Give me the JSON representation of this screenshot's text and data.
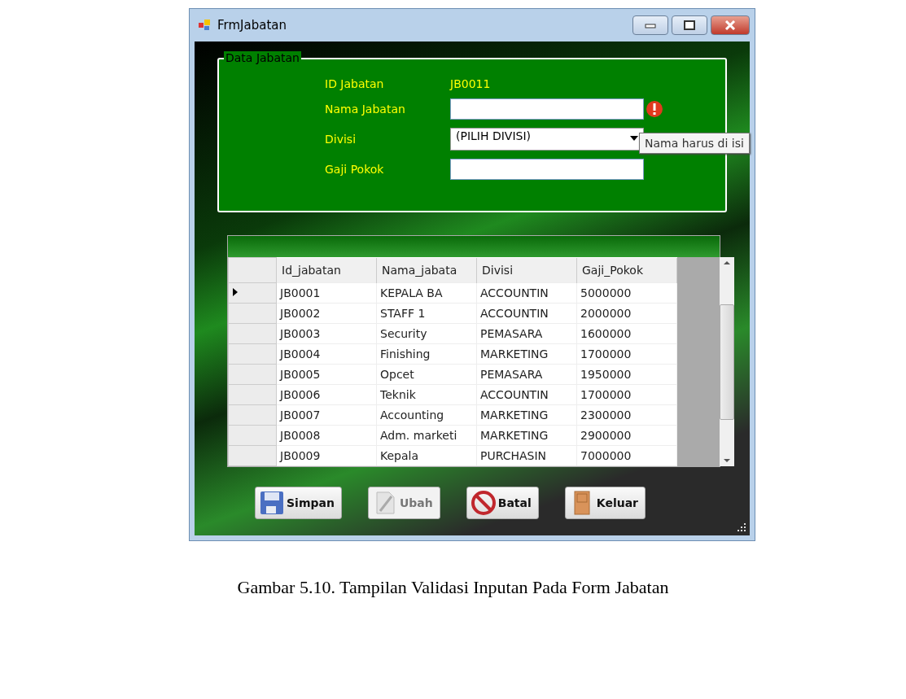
{
  "window": {
    "title": "FrmJabatan"
  },
  "group": {
    "title": "Data Jabatan",
    "fields": [
      {
        "kind": "text",
        "label": "ID Jabatan",
        "value": "JB0011",
        "error": false
      },
      {
        "kind": "input",
        "label": "Nama Jabatan",
        "error": true
      },
      {
        "kind": "combo",
        "label": "Divisi",
        "value": "(PILIH DIVISI)",
        "error": false
      },
      {
        "kind": "input",
        "label": "Gaji Pokok",
        "error": false
      }
    ]
  },
  "tooltip": "Nama harus di isi",
  "table": {
    "columns": [
      "Id_jabatan",
      "Nama_jabata",
      "Divisi",
      "Gaji_Pokok"
    ],
    "rows": [
      {
        "selected": true,
        "cells": [
          "JB0001",
          "KEPALA BA",
          "ACCOUNTIN",
          "5000000"
        ]
      },
      {
        "selected": false,
        "cells": [
          "JB0002",
          "STAFF 1",
          "ACCOUNTIN",
          "2000000"
        ]
      },
      {
        "selected": false,
        "cells": [
          "JB0003",
          "Security",
          "PEMASARA",
          "1600000"
        ]
      },
      {
        "selected": false,
        "cells": [
          "JB0004",
          "Finishing",
          "MARKETING",
          "1700000"
        ]
      },
      {
        "selected": false,
        "cells": [
          "JB0005",
          "Opcet",
          "PEMASARA",
          "1950000"
        ]
      },
      {
        "selected": false,
        "cells": [
          "JB0006",
          "Teknik",
          "ACCOUNTIN",
          "1700000"
        ]
      },
      {
        "selected": false,
        "cells": [
          "JB0007",
          "Accounting",
          "MARKETING",
          "2300000"
        ]
      },
      {
        "selected": false,
        "cells": [
          "JB0008",
          "Adm. marketi",
          "MARKETING",
          "2900000"
        ]
      },
      {
        "selected": false,
        "cells": [
          "JB0009",
          "Kepala",
          "PURCHASIN",
          "7000000"
        ]
      }
    ]
  },
  "buttons": [
    {
      "kind": "save",
      "label": "Simpan",
      "disabled": false
    },
    {
      "kind": "edit",
      "label": "Ubah",
      "disabled": true
    },
    {
      "kind": "cancel",
      "label": "Batal",
      "disabled": false
    },
    {
      "kind": "exit",
      "label": "Keluar",
      "disabled": false
    }
  ],
  "caption": "Gambar 5.10. Tampilan Validasi Inputan Pada Form Jabatan"
}
